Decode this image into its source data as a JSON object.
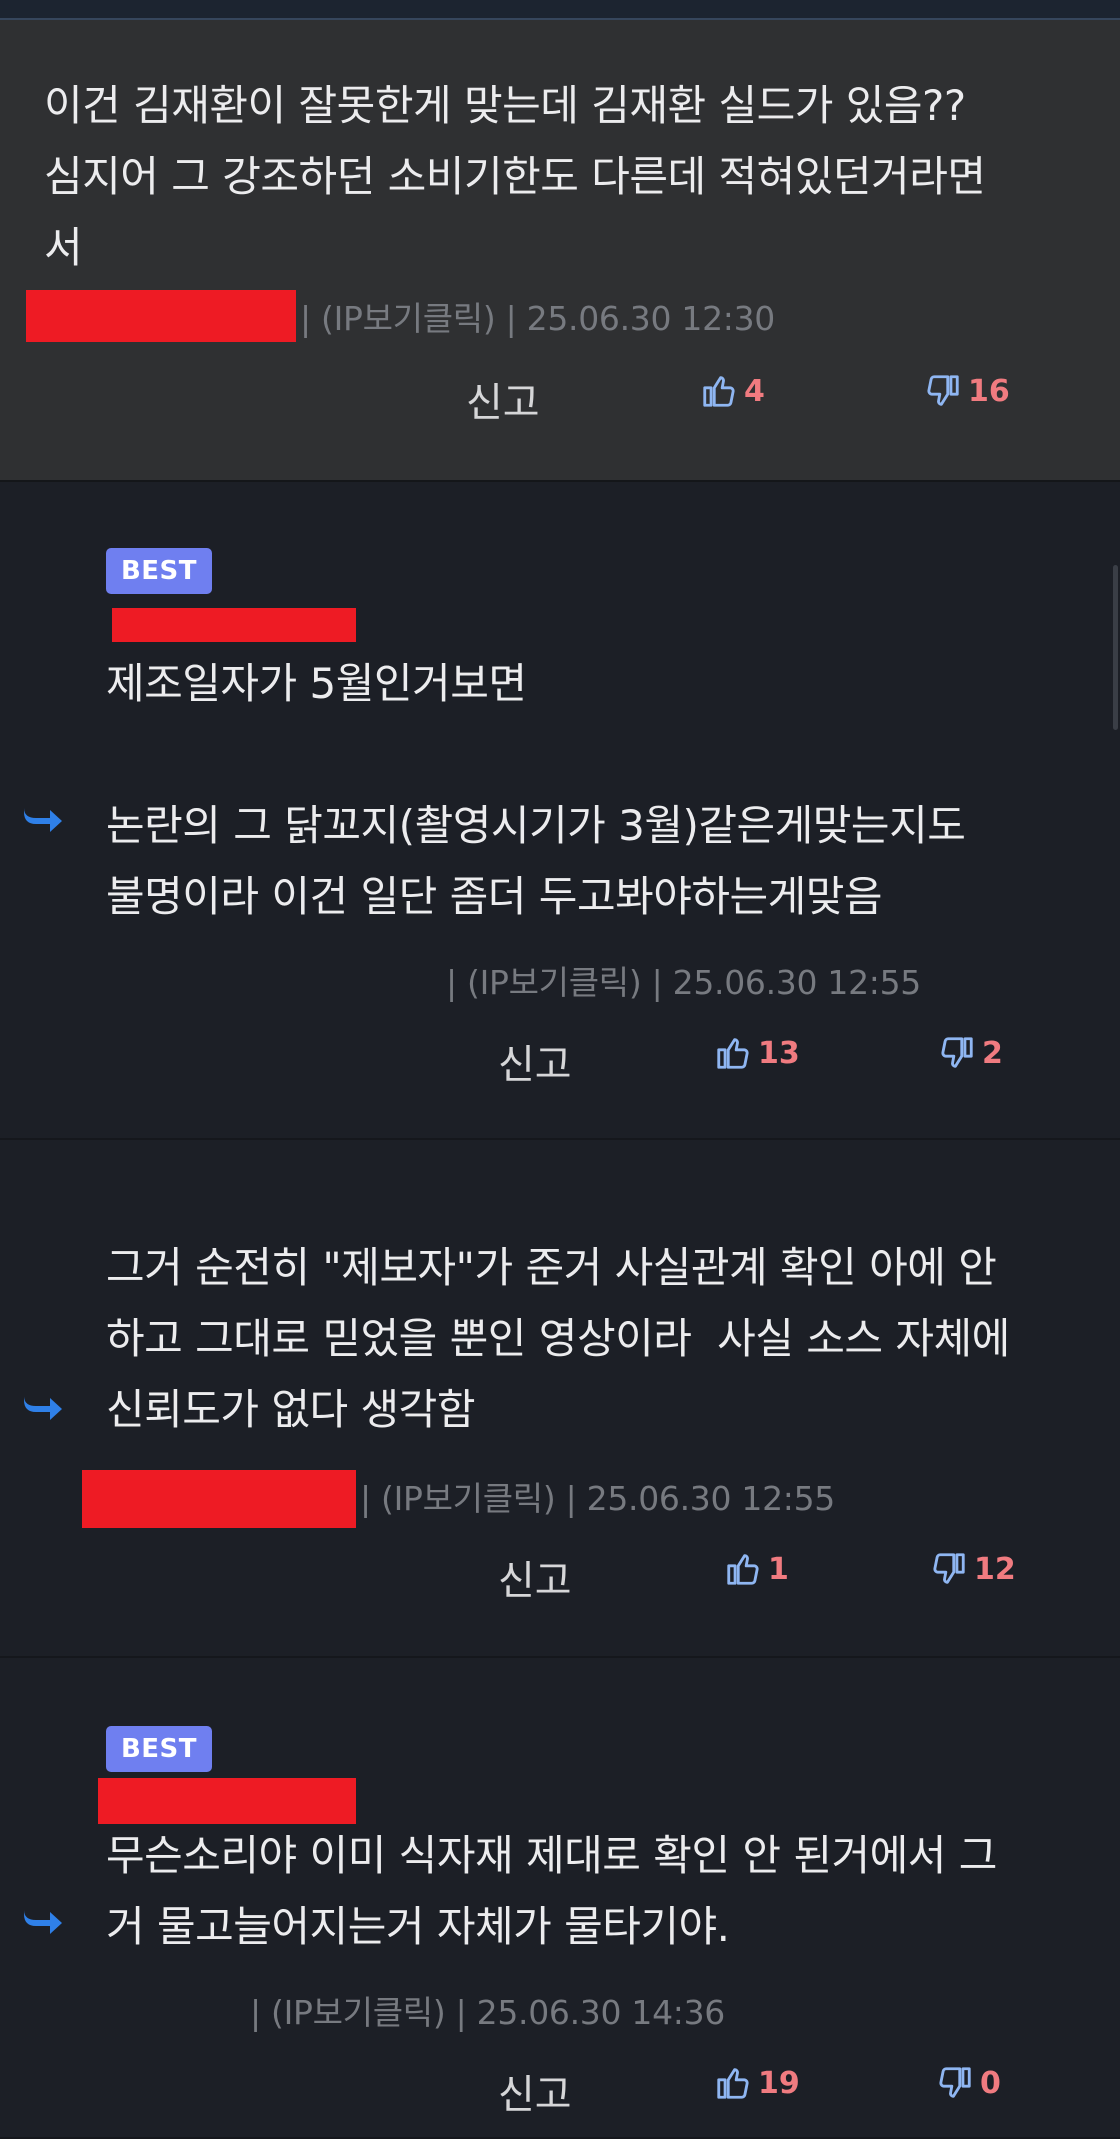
{
  "comments": [
    {
      "text": "이건 김재환이 잘못한게 맞는데 김재환 실드가 있음??\n심지어 그 강조하던 소비기한도 다른데 적혀있던거라면\n서",
      "meta": "| (IP보기클릭) | 25.06.30 12:30",
      "report": "신고",
      "likes": "4",
      "dislikes": "16"
    },
    {
      "best": "BEST",
      "text": "제조일자가 5월인거보면\n\n논란의 그 닭꼬지(촬영시기가 3월)같은게맞는지도\n불명이라 이건 일단 좀더 두고봐야하는게맞음",
      "meta": "| (IP보기클릭) | 25.06.30 12:55",
      "report": "신고",
      "likes": "13",
      "dislikes": "2"
    },
    {
      "text": "그거 순전히 \"제보자\"가 준거 사실관계 확인 아에 안\n하고 그대로 믿었을 뿐인 영상이라  사실 소스 자체에\n신뢰도가 없다 생각함",
      "meta": "| (IP보기클릭) | 25.06.30 12:55",
      "report": "신고",
      "likes": "1",
      "dislikes": "12"
    },
    {
      "best": "BEST",
      "text": "무슨소리야 이미 식자재 제대로 확인 안 된거에서 그\n거 물고늘어지는거 자체가 물타기야.",
      "meta": "| (IP보기클릭) | 25.06.30 14:36",
      "report": "신고",
      "likes": "19",
      "dislikes": "0"
    }
  ],
  "icons": {
    "like": "thumbs-up-icon",
    "dislike": "thumbs-down-icon",
    "reply": "reply-arrow-icon"
  },
  "colors": {
    "like_icon": "#8fb6f2",
    "count": "#f07b80",
    "best_badge": "#6f7ff0",
    "reply_arrow": "#2f80e8",
    "redaction": "#ee1b24"
  }
}
